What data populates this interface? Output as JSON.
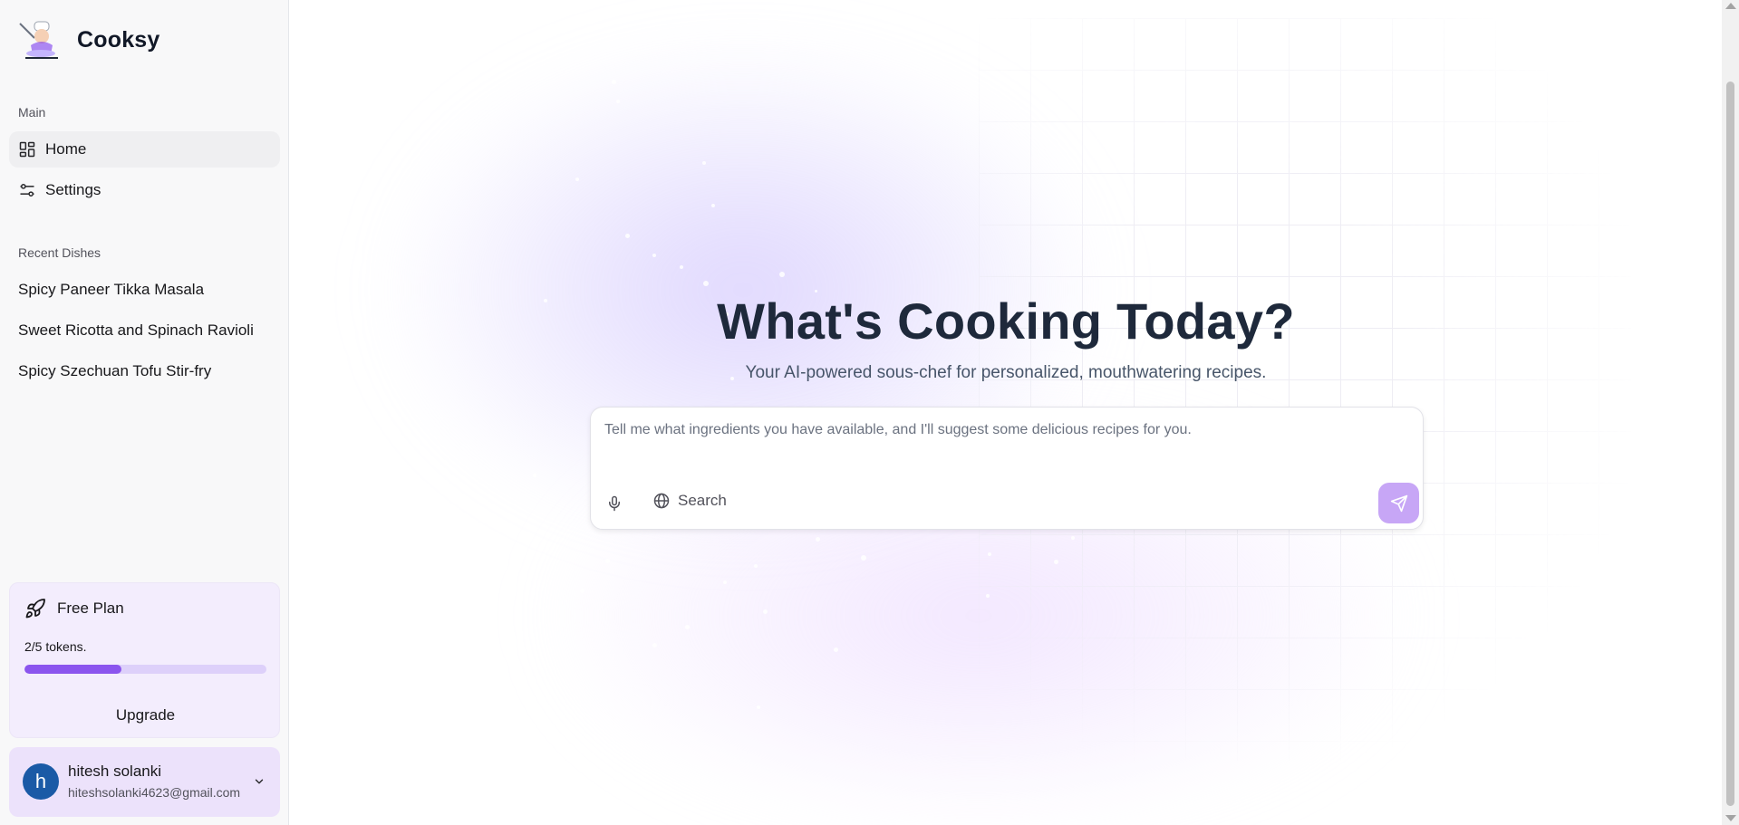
{
  "app": {
    "name": "Cooksy",
    "logo_icon": "chef-mascot-icon"
  },
  "sidebar": {
    "main_label": "Main",
    "nav": [
      {
        "label": "Home",
        "icon": "dashboard-icon",
        "active": true
      },
      {
        "label": "Settings",
        "icon": "sliders-icon",
        "active": false
      }
    ],
    "recent_label": "Recent Dishes",
    "recent": [
      "Spicy Paneer Tikka Masala",
      "Sweet Ricotta and Spinach Ravioli",
      "Spicy Szechuan Tofu Stir-fry"
    ]
  },
  "plan": {
    "name": "Free Plan",
    "icon": "rocket-icon",
    "tokens_text": "2/5 tokens.",
    "tokens_used": 2,
    "tokens_total": 5,
    "progress_fraction": 0.4,
    "upgrade_label": "Upgrade",
    "accent": "#8b55ee"
  },
  "user": {
    "initial": "h",
    "name": "hitesh solanki",
    "email": "hiteshsolanki4623@gmail.com",
    "avatar_color": "#1a5aa6"
  },
  "hero": {
    "title": "What's Cooking Today?",
    "subtitle": "Your AI-powered sous-chef for personalized, mouthwatering recipes."
  },
  "composer": {
    "placeholder": "Tell me what ingredients you have available, and I'll suggest some delicious recipes for you.",
    "value": "",
    "search_label": "Search",
    "send_color": "#c7a6f6"
  }
}
